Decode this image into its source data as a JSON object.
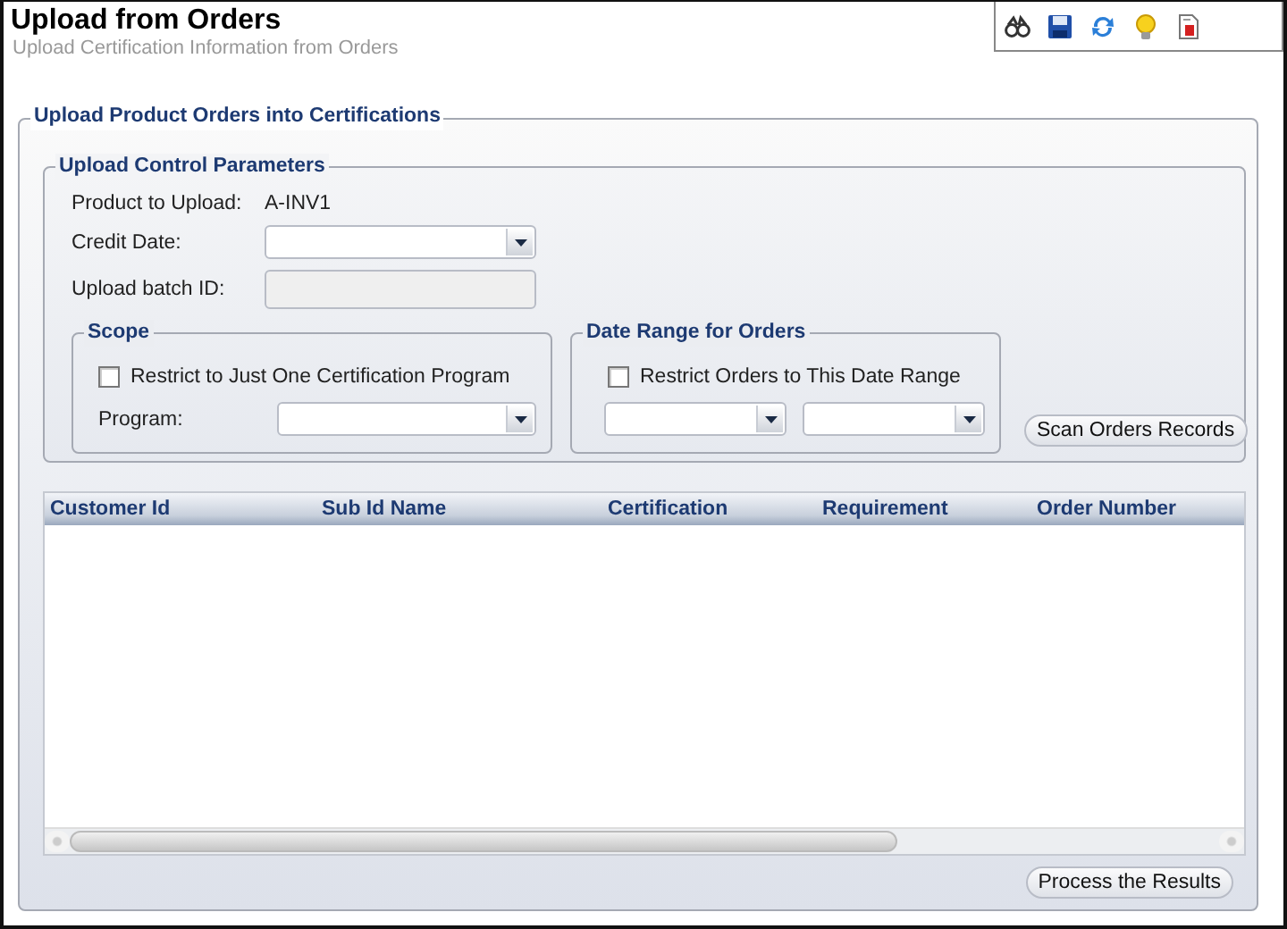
{
  "page": {
    "title": "Upload from Orders",
    "subtitle": "Upload Certification Information from Orders"
  },
  "upload_panel": {
    "title": "Upload Product Orders into Certifications",
    "control_parameters": {
      "title": "Upload Control Parameters",
      "product_label": "Product to Upload:",
      "product_value": "A-INV1",
      "credit_date_label": "Credit Date:",
      "batch_id_label": "Upload batch ID:",
      "batch_id_disabled": true
    },
    "scope": {
      "title": "Scope",
      "checkbox": {
        "label": "Restrict to Just One Certification Program",
        "checked": false
      },
      "program_label": "Program:"
    },
    "date_range": {
      "title": "Date Range for Orders",
      "checkbox": {
        "label": "Restrict Orders to This Date Range",
        "checked": false
      }
    },
    "scan_button": "Scan Orders Records",
    "table": {
      "columns": [
        "Customer Id",
        "Sub Id Name",
        "Certification",
        "Requirement",
        "Order Number"
      ]
    },
    "process_button": "Process the Results"
  }
}
